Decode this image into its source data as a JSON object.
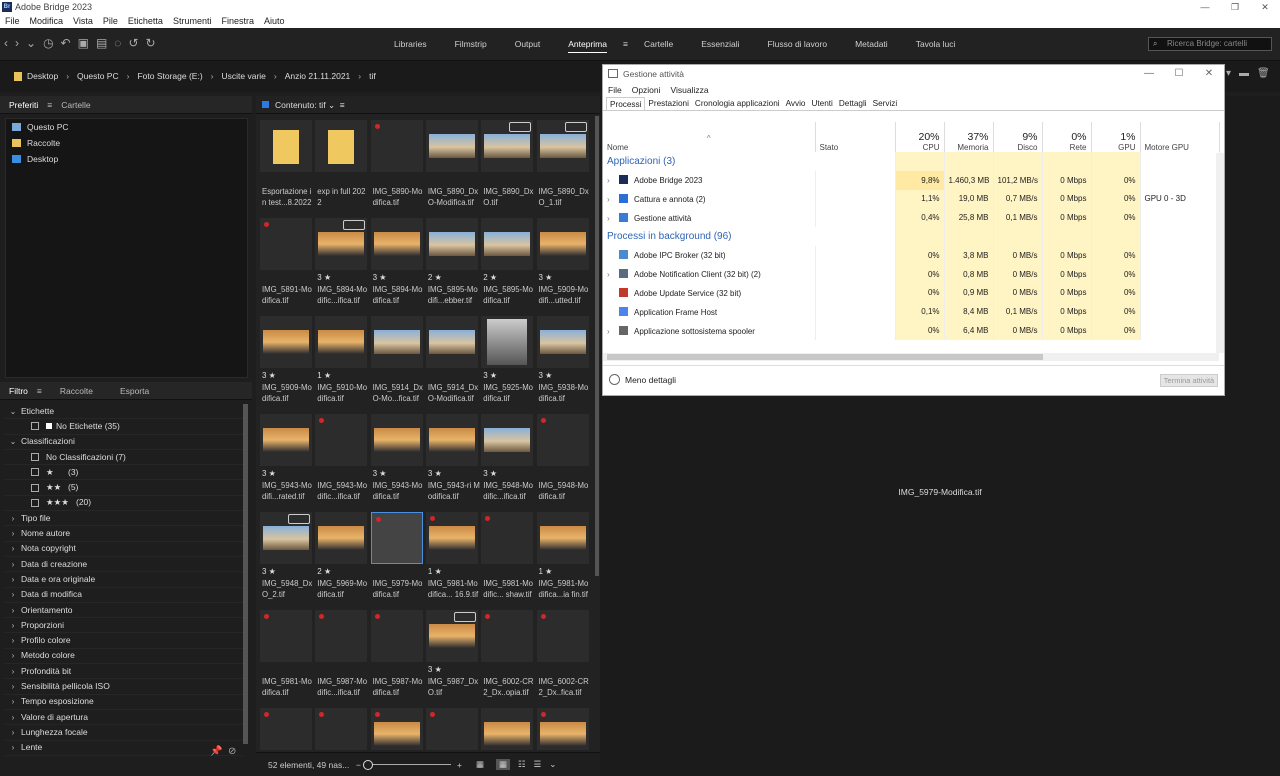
{
  "app": {
    "title": "Adobe Bridge 2023",
    "logo": "Br"
  },
  "menu": [
    "File",
    "Modifica",
    "Vista",
    "Pile",
    "Etichetta",
    "Strumenti",
    "Finestra",
    "Aiuto"
  ],
  "workspaces": [
    "Libraries",
    "Filmstrip",
    "Output",
    "Anteprima",
    "Cartelle",
    "Essenziali",
    "Flusso di lavoro",
    "Metadati",
    "Tavola luci"
  ],
  "active_workspace": "Anteprima",
  "search": {
    "placeholder": "Ricerca Bridge: cartelli"
  },
  "breadcrumbs": [
    "Desktop",
    "Questo PC",
    "Foto Storage (E:)",
    "Uscite varie",
    "Anzio 21.11.2021",
    "tif"
  ],
  "left_tabs": {
    "tab1": "Preferiti",
    "tab2": "Cartelle"
  },
  "favorites": [
    "Questo PC",
    "Raccolte",
    "Desktop"
  ],
  "filter_tabs": {
    "tab1": "Filtro",
    "tab2": "Raccolte",
    "tab3": "Esporta"
  },
  "filters": {
    "etichette": "Etichette",
    "no_etichette": "No Etichette",
    "no_etichette_count": "(35)",
    "classificazioni": "Classificazioni",
    "no_class": "No Classificazioni",
    "no_class_count": "(7)",
    "r1": "★",
    "r1c": "(3)",
    "r2": "★★",
    "r2c": "(5)",
    "r3": "★★★",
    "r3c": "(20)",
    "others": [
      "Tipo file",
      "Nome autore",
      "Nota copyright",
      "Data di creazione",
      "Data e ora originale",
      "Data di modifica",
      "Orientamento",
      "Proporzioni",
      "Profilo colore",
      "Metodo colore",
      "Profondità bit",
      "Sensibilità pellicola ISO",
      "Tempo esposizione",
      "Valore di apertura",
      "Lunghezza focale",
      "Lente"
    ]
  },
  "content": {
    "header": "Contenuto: tif",
    "footer_count": "52 elementi, 49 nas..."
  },
  "thumbs": [
    {
      "name": "Esportazione in test...8.2022",
      "kind": "folder",
      "rating": "",
      "label": false,
      "badge": false
    },
    {
      "name": "exp in full 2022",
      "kind": "folder",
      "rating": "",
      "label": false,
      "badge": false
    },
    {
      "name": "IMG_5890-Modifica.tif",
      "kind": "empty",
      "rating": "",
      "label": true,
      "badge": false
    },
    {
      "name": "IMG_5890_DxO-Modifica.tif",
      "kind": "img",
      "rating": "",
      "label": false,
      "badge": false
    },
    {
      "name": "IMG_5890_DxO.tif",
      "kind": "img",
      "rating": "",
      "label": false,
      "badge": true
    },
    {
      "name": "IMG_5890_DxO_1.tif",
      "kind": "img",
      "rating": "",
      "label": false,
      "badge": true
    },
    {
      "name": "IMG_5891-Modifica.tif",
      "kind": "empty",
      "rating": "",
      "label": true,
      "badge": false
    },
    {
      "name": "IMG_5894-Modific...ifica.tif",
      "kind": "sunset",
      "rating": "3 ★",
      "label": false,
      "badge": true
    },
    {
      "name": "IMG_5894-Modifica.tif",
      "kind": "sunset",
      "rating": "3 ★",
      "label": false,
      "badge": false
    },
    {
      "name": "IMG_5895-Modifi...ebber.tif",
      "kind": "img",
      "rating": "2 ★",
      "label": false,
      "badge": false
    },
    {
      "name": "IMG_5895-Modifica.tif",
      "kind": "img",
      "rating": "2 ★",
      "label": false,
      "badge": false
    },
    {
      "name": "IMG_5909-Modifi...utted.tif",
      "kind": "sunset",
      "rating": "3 ★",
      "label": false,
      "badge": false
    },
    {
      "name": "IMG_5909-Modifica.tif",
      "kind": "sunset",
      "rating": "3 ★",
      "label": false,
      "badge": false
    },
    {
      "name": "IMG_5910-Modifica.tif",
      "kind": "sunset",
      "rating": "1 ★",
      "label": false,
      "badge": false
    },
    {
      "name": "IMG_5914_DxO-Mo...fica.tif",
      "kind": "img",
      "rating": "",
      "label": false,
      "badge": false
    },
    {
      "name": "IMG_5914_DxO-Modifica.tif",
      "kind": "img",
      "rating": "",
      "label": false,
      "badge": false
    },
    {
      "name": "IMG_5925-Modifica.tif",
      "kind": "portrait",
      "rating": "3 ★",
      "label": false,
      "badge": false
    },
    {
      "name": "IMG_5938-Modifica.tif",
      "kind": "img",
      "rating": "3 ★",
      "label": false,
      "badge": false
    },
    {
      "name": "IMG_5943-Modifi...rated.tif",
      "kind": "sunset",
      "rating": "3 ★",
      "label": false,
      "badge": false
    },
    {
      "name": "IMG_5943-Modific...ifica.tif",
      "kind": "empty",
      "rating": "",
      "label": true,
      "badge": false
    },
    {
      "name": "IMG_5943-Modifica.tif",
      "kind": "sunset",
      "rating": "3 ★",
      "label": false,
      "badge": false
    },
    {
      "name": "IMG_5943-ri Modifica.tif",
      "kind": "sunset",
      "rating": "3 ★",
      "label": false,
      "badge": false
    },
    {
      "name": "IMG_5948-Modific...ifica.tif",
      "kind": "img",
      "rating": "3 ★",
      "label": false,
      "badge": false
    },
    {
      "name": "IMG_5948-Modifica.tif",
      "kind": "empty",
      "rating": "",
      "label": true,
      "badge": false
    },
    {
      "name": "IMG_5948_DxO_2.tif",
      "kind": "img",
      "rating": "3 ★",
      "label": false,
      "badge": true
    },
    {
      "name": "IMG_5969-Modifica.tif",
      "kind": "sunset",
      "rating": "2 ★",
      "label": false,
      "badge": false
    },
    {
      "name": "IMG_5979-Modifica.tif",
      "kind": "selected",
      "rating": "",
      "label": true,
      "badge": false
    },
    {
      "name": "IMG_5981-Modifica... 16.9.tif",
      "kind": "sunset",
      "rating": "1 ★",
      "label": true,
      "badge": false
    },
    {
      "name": "IMG_5981-Modific... shaw.tif",
      "kind": "empty",
      "rating": "",
      "label": true,
      "badge": false
    },
    {
      "name": "IMG_5981-Modifica...ia fin.tif",
      "kind": "sunset",
      "rating": "1 ★",
      "label": false,
      "badge": false
    },
    {
      "name": "IMG_5981-Modifica.tif",
      "kind": "empty",
      "rating": "",
      "label": true,
      "badge": false
    },
    {
      "name": "IMG_5987-Modific...ifica.tif",
      "kind": "empty",
      "rating": "",
      "label": true,
      "badge": false
    },
    {
      "name": "IMG_5987-Modifica.tif",
      "kind": "empty",
      "rating": "",
      "label": true,
      "badge": false
    },
    {
      "name": "IMG_5987_DxO.tif",
      "kind": "sunset",
      "rating": "3 ★",
      "label": false,
      "badge": true
    },
    {
      "name": "IMG_6002-CR2_Dx..opia.tif",
      "kind": "empty",
      "rating": "",
      "label": true,
      "badge": false
    },
    {
      "name": "IMG_6002-CR2_Dx..fica.tif",
      "kind": "empty",
      "rating": "",
      "label": true,
      "badge": false
    },
    {
      "name": "",
      "kind": "empty",
      "rating": "",
      "label": true,
      "badge": false
    },
    {
      "name": "",
      "kind": "empty",
      "rating": "",
      "label": true,
      "badge": false
    },
    {
      "name": "",
      "kind": "sunset",
      "rating": "",
      "label": true,
      "badge": false
    },
    {
      "name": "",
      "kind": "empty",
      "rating": "",
      "label": true,
      "badge": false
    },
    {
      "name": "",
      "kind": "sunset",
      "rating": "",
      "label": false,
      "badge": false
    },
    {
      "name": "",
      "kind": "sunset",
      "rating": "",
      "label": true,
      "badge": false
    }
  ],
  "preview": {
    "filename": "IMG_5979-Modifica.tif"
  },
  "task_manager": {
    "title": "Gestione attività",
    "menu": [
      "File",
      "Opzioni",
      "Visualizza"
    ],
    "tabs": [
      "Processi",
      "Prestazioni",
      "Cronologia applicazioni",
      "Avvio",
      "Utenti",
      "Dettagli",
      "Servizi"
    ],
    "cols": {
      "name": "Nome",
      "status": "Stato",
      "cpu_pct": "20%",
      "cpu": "CPU",
      "mem_pct": "37%",
      "mem": "Memoria",
      "disk_pct": "9%",
      "disk": "Disco",
      "net_pct": "0%",
      "net": "Rete",
      "gpu_pct": "1%",
      "gpu": "GPU",
      "gpu_engine": "Motore GPU"
    },
    "group_apps": "Applicazioni (3)",
    "group_bg": "Processi in background (96)",
    "apps": [
      {
        "name": "Adobe Bridge 2023",
        "cpu": "9,8%",
        "mem": "1.460,3 MB",
        "disk": "101,2 MB/s",
        "net": "0 Mbps",
        "gpu": "0%",
        "engine": ""
      },
      {
        "name": "Cattura e annota (2)",
        "cpu": "1,1%",
        "mem": "19,0 MB",
        "disk": "0,7 MB/s",
        "net": "0 Mbps",
        "gpu": "0%",
        "engine": "GPU 0 - 3D"
      },
      {
        "name": "Gestione attività",
        "cpu": "0,4%",
        "mem": "25,8 MB",
        "disk": "0,1 MB/s",
        "net": "0 Mbps",
        "gpu": "0%",
        "engine": ""
      }
    ],
    "bg": [
      {
        "name": "Adobe IPC Broker (32 bit)",
        "cpu": "0%",
        "mem": "3,8 MB",
        "disk": "0 MB/s",
        "net": "0 Mbps",
        "gpu": "0%"
      },
      {
        "name": "Adobe Notification Client (32 bit) (2)",
        "cpu": "0%",
        "mem": "0,8 MB",
        "disk": "0 MB/s",
        "net": "0 Mbps",
        "gpu": "0%"
      },
      {
        "name": "Adobe Update Service (32 bit)",
        "cpu": "0%",
        "mem": "0,9 MB",
        "disk": "0 MB/s",
        "net": "0 Mbps",
        "gpu": "0%"
      },
      {
        "name": "Application Frame Host",
        "cpu": "0,1%",
        "mem": "8,4 MB",
        "disk": "0,1 MB/s",
        "net": "0 Mbps",
        "gpu": "0%"
      },
      {
        "name": "Applicazione sottosistema spooler",
        "cpu": "0%",
        "mem": "6,4 MB",
        "disk": "0 MB/s",
        "net": "0 Mbps",
        "gpu": "0%"
      }
    ],
    "less": "Meno dettagli",
    "end_task": "Termina attività"
  }
}
